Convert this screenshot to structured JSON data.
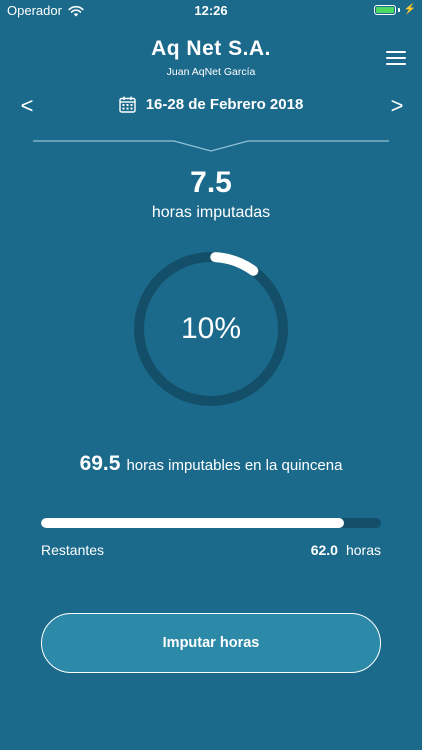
{
  "status_bar": {
    "carrier": "Operador",
    "time": "12:26",
    "battery_color": "#4cd964"
  },
  "header": {
    "company": "Aq Net S.A.",
    "user": "Juan AqNet García"
  },
  "period": {
    "prev": "<",
    "next": ">",
    "range": "16-28 de Febrero  2018"
  },
  "hours": {
    "value": "7.5",
    "label": "horas imputadas",
    "percent_label": "10%",
    "percent_value": 0.1
  },
  "quincena": {
    "value": "69.5",
    "label": "horas imputables en la quincena"
  },
  "remaining": {
    "label": "Restantes",
    "value": "62.0",
    "unit": "horas",
    "bar_fraction": 0.89
  },
  "action": {
    "label": "Imputar horas"
  },
  "colors": {
    "background": "#1b6a8b",
    "track": "#134f68",
    "button": "#2d89a8"
  },
  "icons": {
    "wifi": "wifi-icon",
    "battery": "battery-icon",
    "menu": "hamburger-menu-icon",
    "calendar": "calendar-icon"
  }
}
